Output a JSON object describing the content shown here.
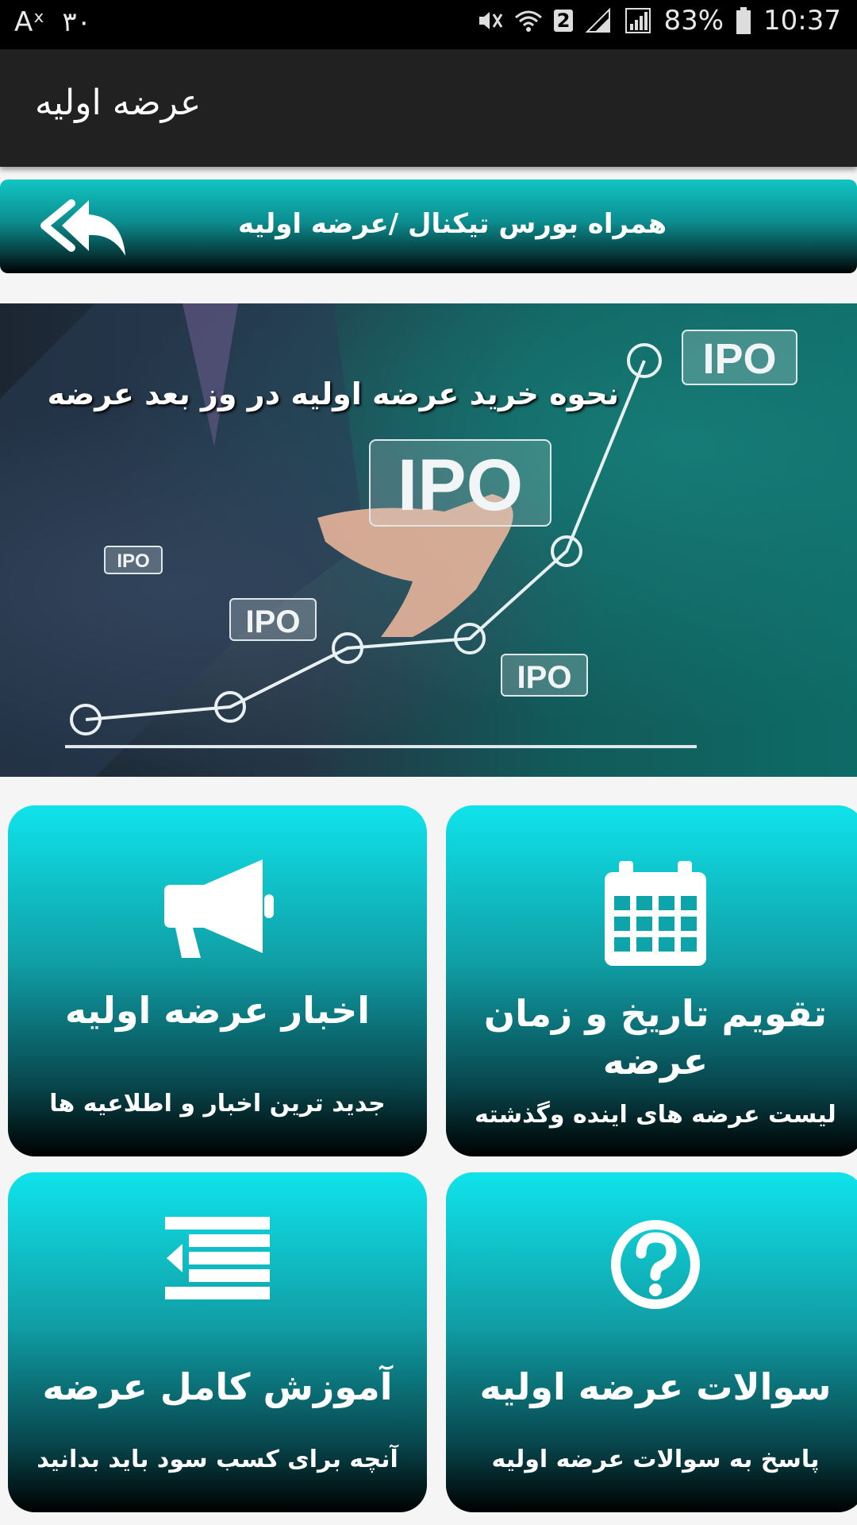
{
  "status_bar": {
    "left_indicator": "Aˣ",
    "left_number": "۳۰",
    "sim_number": "2",
    "battery": "83%",
    "time": "10:37"
  },
  "app_bar": {
    "title": "عرضه اولیه"
  },
  "breadcrumb": {
    "text": "همراه بورس تیکنال /عرضه اولیه"
  },
  "banner": {
    "caption": "نحوه خرید عرضه اولیه در وز بعد عرضه",
    "labels": [
      "IPO",
      "IPO",
      "IPO",
      "IPO",
      "IPO"
    ]
  },
  "cards": [
    {
      "title": "اخبار عرضه اولیه",
      "subtitle": "جدید ترین اخبار و اطلاعیه ها",
      "icon": "megaphone-icon"
    },
    {
      "title": "تقویم تاریخ و زمان عرضه",
      "subtitle": "لیست عرضه های اینده وگذشته",
      "icon": "calendar-icon"
    },
    {
      "title": "آموزش کامل عرضه",
      "subtitle": "آنچه برای کسب سود باید بدانید",
      "icon": "list-icon"
    },
    {
      "title": "سوالات عرضه اولیه",
      "subtitle": "پاسخ به سوالات عرضه اولیه",
      "icon": "question-icon"
    }
  ],
  "colors": {
    "app_bar": "#212121",
    "card_top": "#10e3eb",
    "card_bottom": "#000000"
  }
}
